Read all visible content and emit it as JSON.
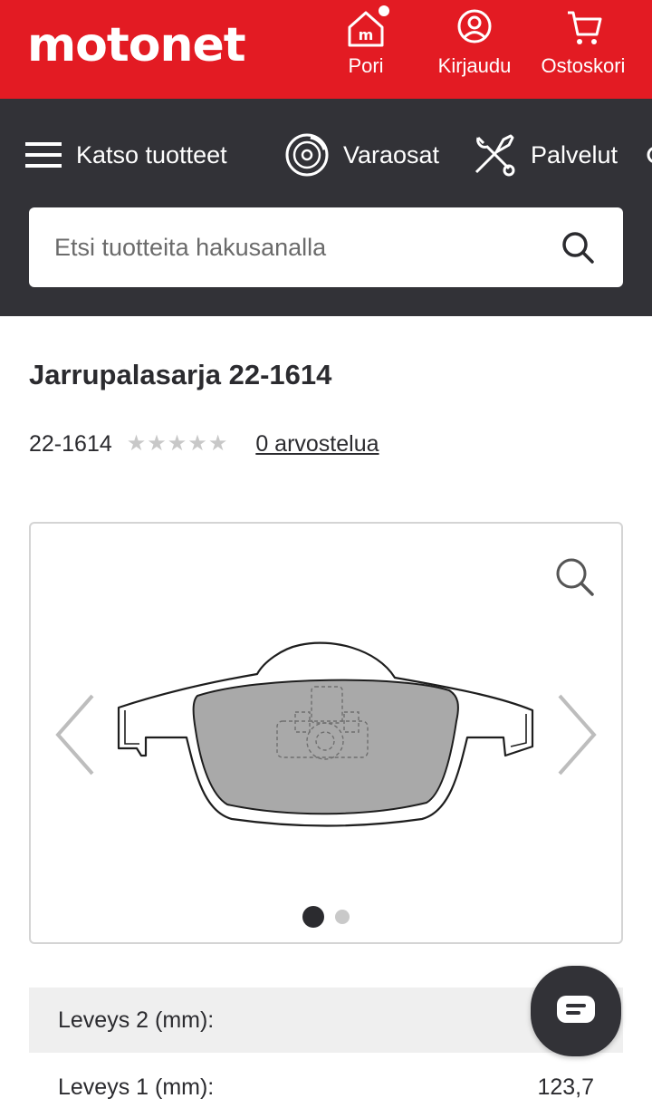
{
  "header": {
    "logo": "motonet",
    "store_label": "Pori",
    "login_label": "Kirjaudu",
    "cart_label": "Ostoskori"
  },
  "nav": {
    "products_label": "Katso tuotteet",
    "parts_label": "Varaosat",
    "services_label": "Palvelut",
    "search_placeholder": "Etsi tuotteita hakusanalla"
  },
  "product": {
    "title": "Jarrupalasarja 22-1614",
    "code": "22-1614",
    "rating": 0,
    "rating_max": 5,
    "reviews_link": "0 arvostelua"
  },
  "gallery": {
    "image_count": 2,
    "active_index": 0
  },
  "specs": [
    {
      "label": "Leveys 2 (mm):",
      "value": ""
    },
    {
      "label": "Leveys 1 (mm):",
      "value": "123,7"
    }
  ],
  "colors": {
    "brand_red": "#e31b23",
    "nav_dark": "#323237"
  }
}
